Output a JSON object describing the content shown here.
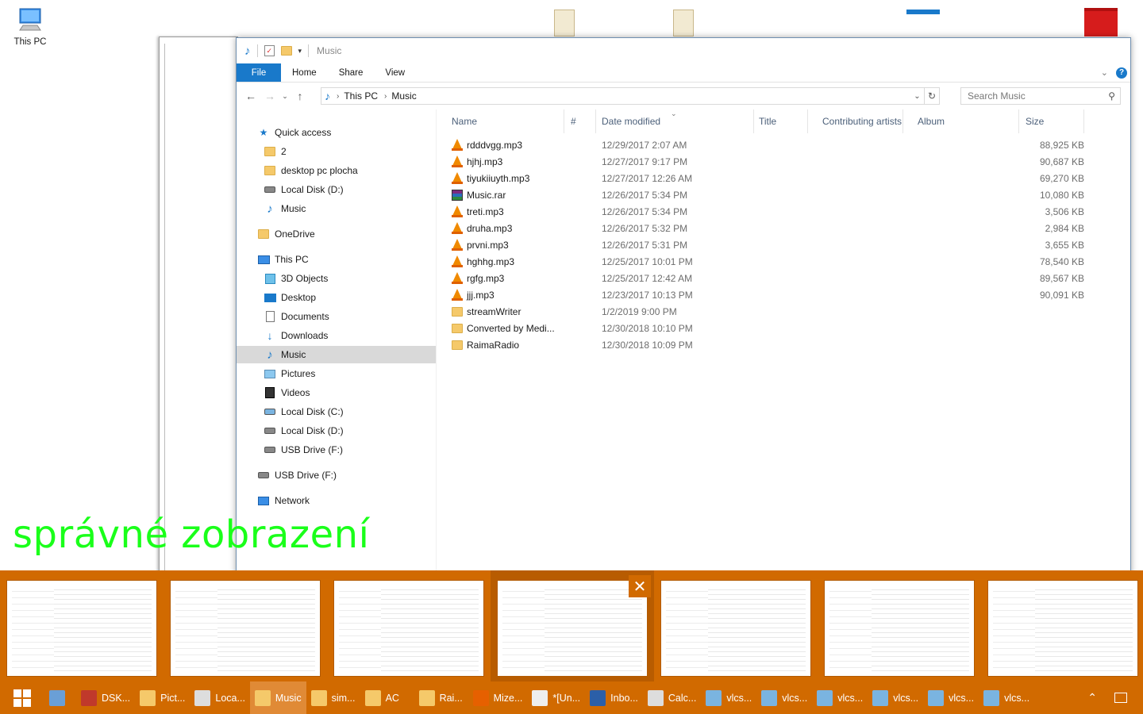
{
  "desktop": {
    "this_pc_label": "This PC",
    "annotation": "správné zobrazení"
  },
  "window": {
    "title": "Music",
    "ribbon_tabs": [
      "File",
      "Home",
      "Share",
      "View"
    ],
    "address": {
      "crumbs": [
        "This PC",
        "Music"
      ]
    },
    "search_placeholder": "Search Music"
  },
  "navpane": {
    "items": [
      {
        "label": "Quick access",
        "icon": "star-icon"
      },
      {
        "label": "2",
        "icon": "folder-icon"
      },
      {
        "label": "desktop pc plocha",
        "icon": "folder-icon"
      },
      {
        "label": "Local Disk (D:)",
        "icon": "drive-icon"
      },
      {
        "label": "Music",
        "icon": "music-icon"
      },
      {
        "label": "OneDrive",
        "icon": "folder-icon"
      },
      {
        "label": "This PC",
        "icon": "computer-icon"
      },
      {
        "label": "3D Objects",
        "icon": "cube-icon"
      },
      {
        "label": "Desktop",
        "icon": "desktop-icon"
      },
      {
        "label": "Documents",
        "icon": "documents-icon"
      },
      {
        "label": "Downloads",
        "icon": "download-icon"
      },
      {
        "label": "Music",
        "icon": "music-icon"
      },
      {
        "label": "Pictures",
        "icon": "pictures-icon"
      },
      {
        "label": "Videos",
        "icon": "videos-icon"
      },
      {
        "label": "Local Disk (C:)",
        "icon": "drive-icon"
      },
      {
        "label": "Local Disk (D:)",
        "icon": "drive-icon"
      },
      {
        "label": "USB Drive (F:)",
        "icon": "usb-icon"
      },
      {
        "label": "USB Drive (F:)",
        "icon": "usb-icon"
      },
      {
        "label": "Network",
        "icon": "network-icon"
      }
    ]
  },
  "columns": [
    "Name",
    "#",
    "Date modified",
    "Title",
    "Contributing artists",
    "Album",
    "Size"
  ],
  "files": [
    {
      "name": "rdddvgg.mp3",
      "date": "12/29/2017 2:07 AM",
      "size": "88,925 KB",
      "icon": "vlc-icon"
    },
    {
      "name": "hjhj.mp3",
      "date": "12/27/2017 9:17 PM",
      "size": "90,687 KB",
      "icon": "vlc-icon"
    },
    {
      "name": "tiyukiiuyth.mp3",
      "date": "12/27/2017 12:26 AM",
      "size": "69,270 KB",
      "icon": "vlc-icon"
    },
    {
      "name": "Music.rar",
      "date": "12/26/2017 5:34 PM",
      "size": "10,080 KB",
      "icon": "rar-icon"
    },
    {
      "name": "treti.mp3",
      "date": "12/26/2017 5:34 PM",
      "size": "3,506 KB",
      "icon": "vlc-icon"
    },
    {
      "name": "druha.mp3",
      "date": "12/26/2017 5:32 PM",
      "size": "2,984 KB",
      "icon": "vlc-icon"
    },
    {
      "name": "prvni.mp3",
      "date": "12/26/2017 5:31 PM",
      "size": "3,655 KB",
      "icon": "vlc-icon"
    },
    {
      "name": "hghhg.mp3",
      "date": "12/25/2017 10:01 PM",
      "size": "78,540 KB",
      "icon": "vlc-icon"
    },
    {
      "name": "rgfg.mp3",
      "date": "12/25/2017 12:42 AM",
      "size": "89,567 KB",
      "icon": "vlc-icon"
    },
    {
      "name": "jjj.mp3",
      "date": "12/23/2017 10:13 PM",
      "size": "90,091 KB",
      "icon": "vlc-icon"
    },
    {
      "name": "streamWriter",
      "date": "1/2/2019 9:00 PM",
      "size": "",
      "icon": "folder-icon"
    },
    {
      "name": "Converted by Medi...",
      "date": "12/30/2018 10:10 PM",
      "size": "",
      "icon": "folder-icon"
    },
    {
      "name": "RaimaRadio",
      "date": "12/30/2018 10:09 PM",
      "size": "",
      "icon": "folder-icon"
    }
  ],
  "taskbar": {
    "items": [
      {
        "label": "",
        "icon": "control-panel-icon"
      },
      {
        "label": "DSK...",
        "icon": "app-icon"
      },
      {
        "label": "Pict...",
        "icon": "folder-icon"
      },
      {
        "label": "Loca...",
        "icon": "drive-icon"
      },
      {
        "label": "Music",
        "icon": "folder-icon",
        "active": true
      },
      {
        "label": "sim...",
        "icon": "folder-icon"
      },
      {
        "label": "AC",
        "icon": "folder-icon"
      },
      {
        "label": "Rai...",
        "icon": "folder-icon"
      },
      {
        "label": "Mize...",
        "icon": "firefox-icon"
      },
      {
        "label": "*[Un...",
        "icon": "notepad-icon"
      },
      {
        "label": "Inbo...",
        "icon": "thunderbird-icon"
      },
      {
        "label": "Calc...",
        "icon": "calculator-icon"
      },
      {
        "label": "vlcs...",
        "icon": "image-icon"
      },
      {
        "label": "vlcs...",
        "icon": "image-icon"
      },
      {
        "label": "vlcs...",
        "icon": "image-icon"
      },
      {
        "label": "vlcs...",
        "icon": "image-icon"
      },
      {
        "label": "vlcs...",
        "icon": "image-icon"
      },
      {
        "label": "vlcs...",
        "icon": "image-icon"
      }
    ]
  },
  "colors": {
    "accent": "#1979ca",
    "taskbar": "#d16a00",
    "annotation": "#1aff1a"
  }
}
